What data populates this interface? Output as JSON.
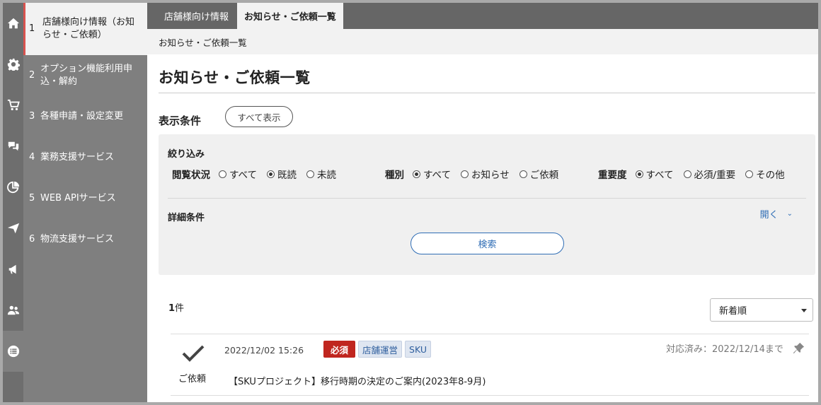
{
  "rail": {
    "icons": [
      "home-icon",
      "gear-icon",
      "cart-icon",
      "chat-icon",
      "pie-chart-icon",
      "paper-plane-icon",
      "megaphone-icon",
      "users-icon",
      "list-icon"
    ]
  },
  "nav": {
    "items": [
      {
        "num": "1",
        "label": "店舗様向け情報（お知らせ・ご依頼）"
      },
      {
        "num": "2",
        "label": "オプション機能利用申込・解約"
      },
      {
        "num": "3",
        "label": "各種申請・設定変更"
      },
      {
        "num": "4",
        "label": "業務支援サービス"
      },
      {
        "num": "5",
        "label": "WEB APIサービス"
      },
      {
        "num": "6",
        "label": "物流支援サービス"
      }
    ]
  },
  "tabs": [
    "店舗様向け情報",
    "お知らせ・ご依頼一覧"
  ],
  "breadcrumb": "お知らせ・ご依頼一覧",
  "page_title": "お知らせ・ご依頼一覧",
  "conditions": {
    "label": "表示条件",
    "show_all": "すべて表示",
    "filter_title": "絞り込み",
    "groups": [
      {
        "label": "閲覧状況",
        "options": [
          "すべて",
          "既読",
          "未読"
        ],
        "selected": "既読"
      },
      {
        "label": "種別",
        "options": [
          "すべて",
          "お知らせ",
          "ご依頼"
        ],
        "selected": "すべて"
      },
      {
        "label": "重要度",
        "options": [
          "すべて",
          "必須/重要",
          "その他"
        ],
        "selected": "すべて"
      }
    ],
    "detail_label": "詳細条件",
    "open_label": "開く",
    "search_label": "検索"
  },
  "results": {
    "count": "1",
    "count_unit": "件",
    "sort_value": "新着順"
  },
  "items": [
    {
      "kind": "ご依頼",
      "date": "2022/12/02 15:26",
      "badge_required": "必須",
      "tags": [
        "店舗運営",
        "SKU"
      ],
      "due": "対応済み：2022/12/14まで",
      "title": "【SKUプロジェクト】移行時期の決定のご案内(2023年8-9月)"
    }
  ],
  "colors": {
    "required_badge": "#c0261f",
    "link": "#2f6db5",
    "nav_bg": "#7f7f7f"
  }
}
